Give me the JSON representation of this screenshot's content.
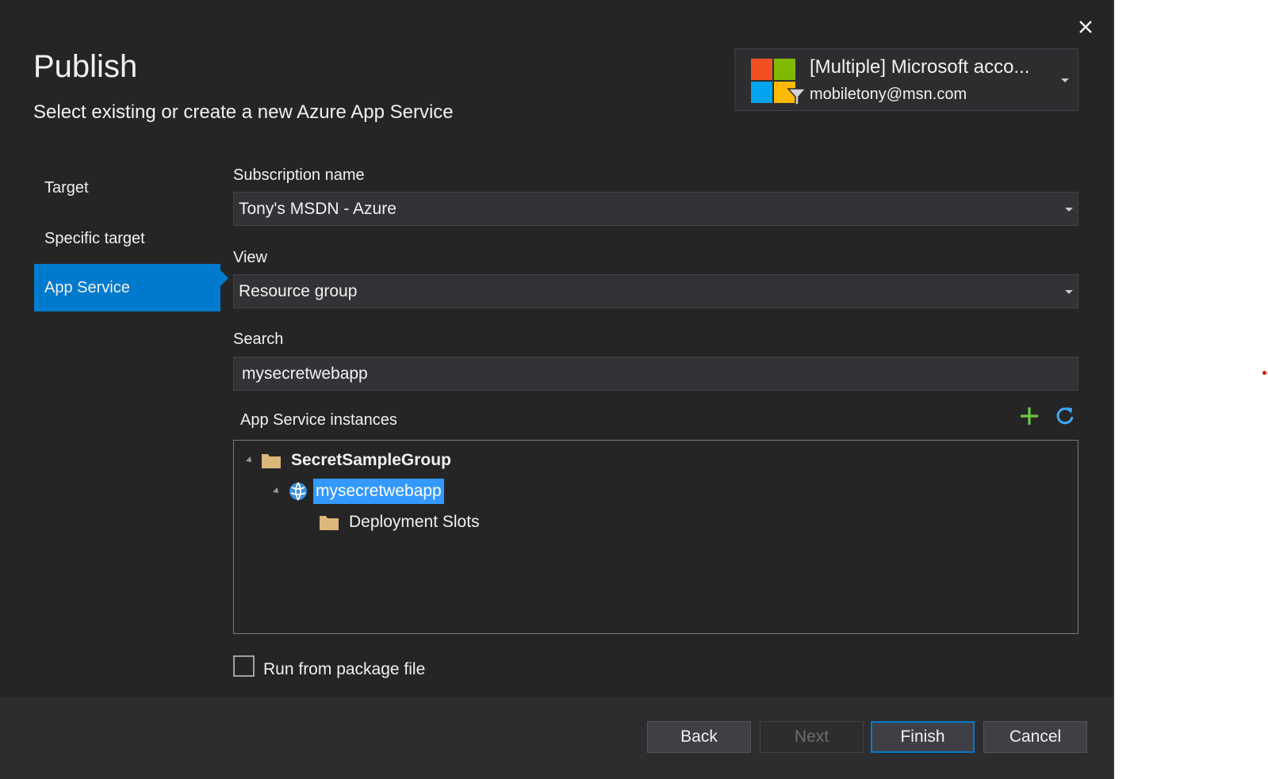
{
  "dialog": {
    "title": "Publish",
    "subtitle": "Select existing or create a new Azure App Service",
    "close_icon": "close-icon"
  },
  "account": {
    "name": "[Multiple] Microsoft acco...",
    "email": "mobiletony@msn.com",
    "logo_colors": [
      "#f25022",
      "#7fba00",
      "#00a4ef",
      "#ffb900"
    ],
    "filter_icon": "filter-icon"
  },
  "nav": {
    "items": [
      {
        "label": "Target"
      },
      {
        "label": "Specific target"
      },
      {
        "label": "App Service",
        "active": true
      }
    ]
  },
  "form": {
    "subscription": {
      "label": "Subscription name",
      "value": "Tony's MSDN - Azure"
    },
    "view": {
      "label": "View",
      "value": "Resource group"
    },
    "search": {
      "label": "Search",
      "value": "mysecretwebapp"
    }
  },
  "instances": {
    "label": "App Service instances",
    "add_icon": "plus-icon",
    "refresh_icon": "refresh-icon",
    "tree": [
      {
        "label": "SecretSampleGroup",
        "icon": "folder-icon",
        "expanded": true
      },
      {
        "label": "mysecretwebapp",
        "icon": "web-app-globe-icon",
        "expanded": true,
        "selected": true
      },
      {
        "label": "Deployment Slots",
        "icon": "folder-icon"
      }
    ]
  },
  "options": {
    "run_from_package": {
      "label": "Run from package file",
      "checked": false
    }
  },
  "buttons": {
    "back": "Back",
    "next": "Next",
    "finish": "Finish",
    "cancel": "Cancel"
  },
  "colors": {
    "accent": "#007acc",
    "selection": "#3399ff",
    "add": "#6cc644",
    "folder": "#dcb67a",
    "background": "#252526"
  }
}
